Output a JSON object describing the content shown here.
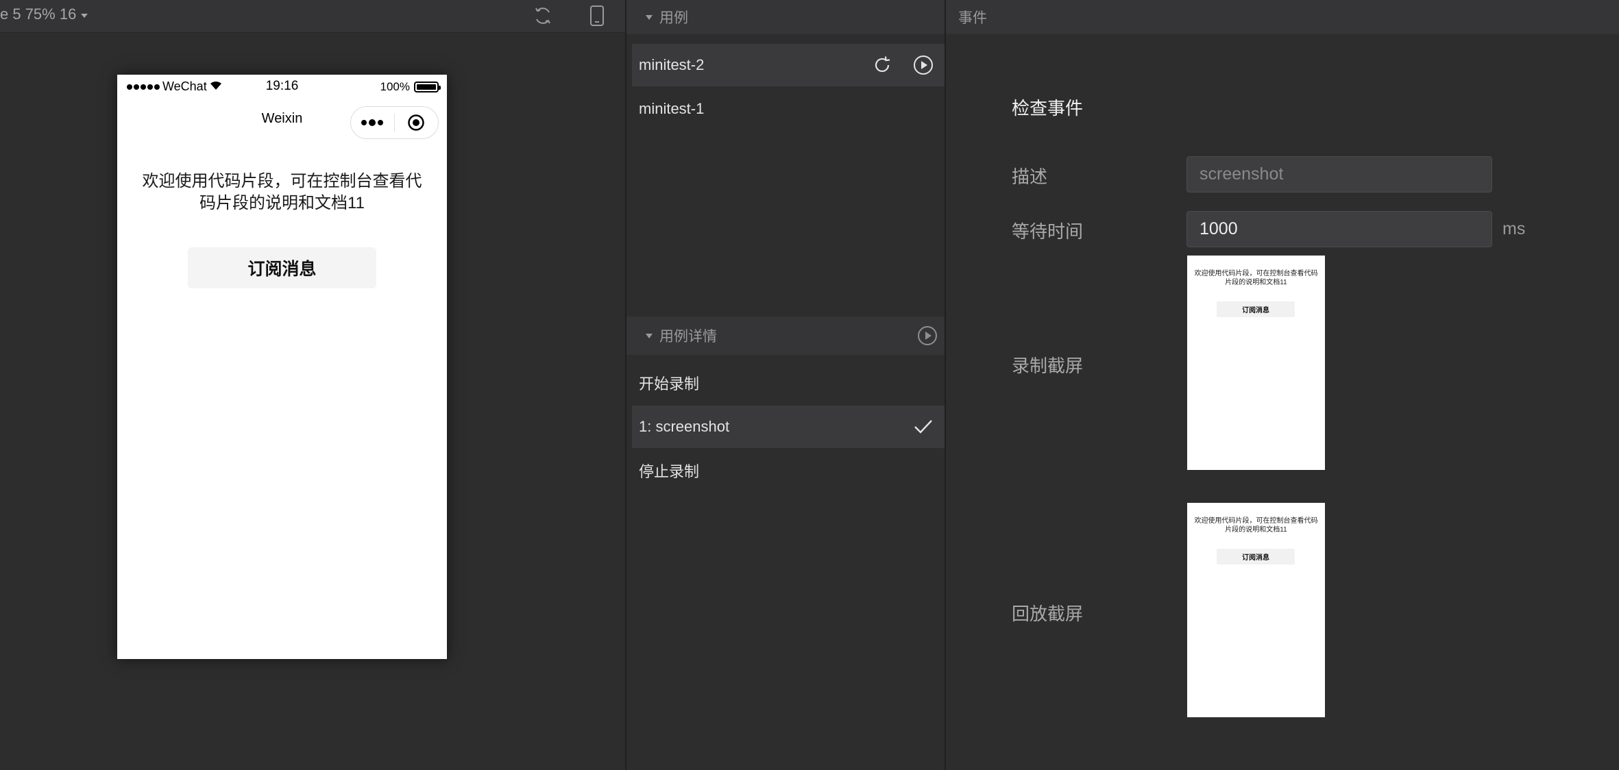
{
  "simulator": {
    "device_label": "e 5 75% 16",
    "status_bar": {
      "carrier": "WeChat",
      "time": "19:16",
      "battery": "100%",
      "battery_level": 1.0
    },
    "nav_title": "Weixin",
    "intro_text": "欢迎使用代码片段，可在控制台查看代码片段的说明和文档11",
    "subscribe_button": "订阅消息"
  },
  "cases": {
    "header": "用例",
    "items": [
      {
        "label": "minitest-2",
        "selected": true
      },
      {
        "label": "minitest-1",
        "selected": false
      }
    ]
  },
  "case_detail": {
    "header": "用例详情",
    "steps": [
      {
        "label": "开始录制"
      },
      {
        "label": "1: screenshot",
        "done": true
      },
      {
        "label": "停止录制"
      }
    ]
  },
  "event": {
    "header": "事件",
    "title": "检查事件",
    "description_label": "描述",
    "description_placeholder": "screenshot",
    "wait_label": "等待时间",
    "wait_value": "1000",
    "wait_unit": "ms",
    "record_label": "录制截屏",
    "replay_label": "回放截屏",
    "thumb_text": "欢迎使用代码片段，可在控制台查看代码片段的说明和文档11",
    "thumb_button": "订阅消息"
  },
  "colors": {
    "background": "#2d2d2e",
    "header": "#353537",
    "selected_row": "#3a3a3c"
  }
}
